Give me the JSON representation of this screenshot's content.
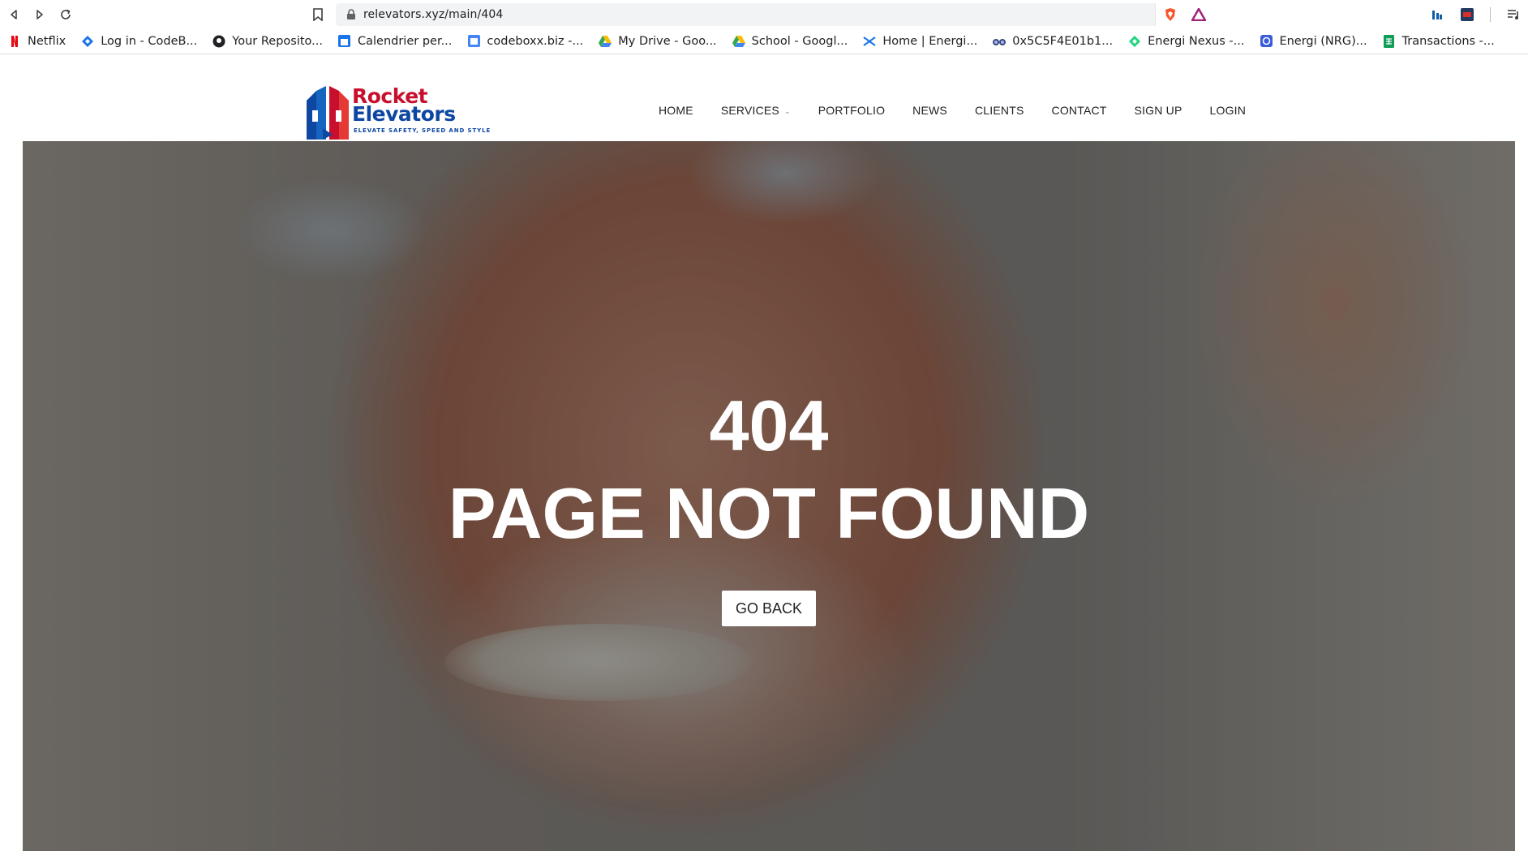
{
  "browser": {
    "url_text": "relevators.xyz/main/404",
    "bookmarks": [
      {
        "label": "Netflix",
        "icon": "netflix-icon"
      },
      {
        "label": "Log in - CodeB...",
        "icon": "codeboxx-icon"
      },
      {
        "label": "Your Reposito...",
        "icon": "github-icon"
      },
      {
        "label": "Calendrier per...",
        "icon": "calendar-icon"
      },
      {
        "label": "codeboxx.biz -...",
        "icon": "codeboxx-calendar-icon"
      },
      {
        "label": "My Drive - Goo...",
        "icon": "google-drive-icon"
      },
      {
        "label": "School - Googl...",
        "icon": "google-drive-icon"
      },
      {
        "label": "Home | Energi...",
        "icon": "energi-icon"
      },
      {
        "label": "0x5C5F4E01b1...",
        "icon": "binoculars-icon"
      },
      {
        "label": "Energi Nexus -...",
        "icon": "nexus-icon"
      },
      {
        "label": "Energi (NRG)...",
        "icon": "coin-icon"
      },
      {
        "label": "Transactions -...",
        "icon": "sheets-icon"
      }
    ]
  },
  "site": {
    "logo": {
      "word1": "Rocket",
      "word2": "Elevators",
      "tagline": "ELEVATE SAFETY, SPEED AND STYLE"
    },
    "nav": {
      "home": "HOME",
      "services": "SERVICES",
      "portfolio": "PORTFOLIO",
      "news": "NEWS",
      "clients": "CLIENTS",
      "contact": "CONTACT",
      "signup": "SIGN UP",
      "login": "LOGIN"
    }
  },
  "hero": {
    "code": "404",
    "message": "PAGE NOT FOUND",
    "button": "GO BACK"
  },
  "colors": {
    "brand_red": "#c8102e",
    "brand_blue": "#0d47a1",
    "nav_text": "#222222"
  }
}
